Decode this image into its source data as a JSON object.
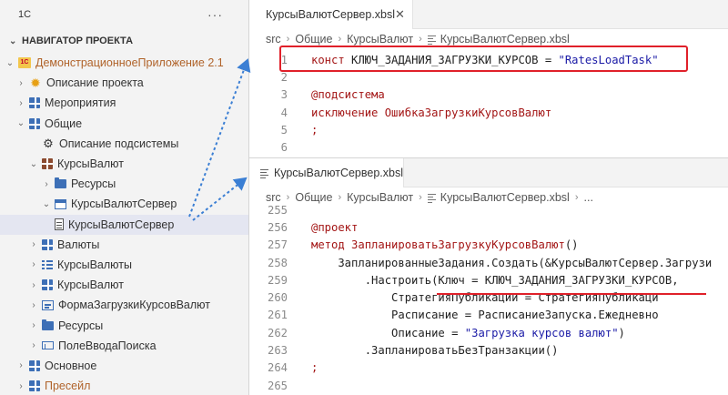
{
  "sidebar": {
    "title": "1С",
    "more": "···",
    "section": "НАВИГАТОР ПРОЕКТА",
    "tree": [
      {
        "label": "ДемонстрационноеПриложение 2.1",
        "icon": "project-1c-icon"
      },
      {
        "label": "Описание проекта",
        "icon": "gear-icon"
      },
      {
        "label": "Мероприятия",
        "icon": "grid-icon"
      },
      {
        "label": "Общие",
        "icon": "grid-icon"
      },
      {
        "label": "Описание подсистемы",
        "icon": "gears-icon"
      },
      {
        "label": "КурсыВалют",
        "icon": "grid-icon"
      },
      {
        "label": "Ресурсы",
        "icon": "folder-icon"
      },
      {
        "label": "КурсыВалютСервер",
        "icon": "module-icon"
      },
      {
        "label": "КурсыВалютСервер",
        "icon": "file-icon"
      },
      {
        "label": "Валюты",
        "icon": "grid-icon"
      },
      {
        "label": "КурсыВалюты",
        "icon": "enum-icon"
      },
      {
        "label": "КурсыВалют",
        "icon": "grid-icon"
      },
      {
        "label": "ФормаЗагрузкиКурсовВалют",
        "icon": "form-icon"
      },
      {
        "label": "Ресурсы",
        "icon": "folder-icon"
      },
      {
        "label": "ПолеВводаПоиска",
        "icon": "input-icon"
      },
      {
        "label": "Основное",
        "icon": "grid-icon"
      },
      {
        "label": "Пресейл",
        "icon": "grid-icon"
      }
    ]
  },
  "pane1": {
    "tab": "КурсыВалютСервер.xbsl",
    "breadcrumb": [
      "src",
      "Общие",
      "КурсыВалют",
      "КурсыВалютСервер.xbsl"
    ],
    "lines": [
      {
        "n": "1",
        "parts": [
          [
            "kw",
            "конст "
          ],
          [
            "",
            "КЛЮЧ_ЗАДАНИЯ_ЗАГРУЗКИ_КУРСОВ = "
          ],
          [
            "str",
            "\"RatesLoadTask\""
          ]
        ]
      },
      {
        "n": "2",
        "parts": []
      },
      {
        "n": "3",
        "parts": [
          [
            "ann",
            "@подсистема"
          ]
        ]
      },
      {
        "n": "4",
        "parts": [
          [
            "kw",
            "исключение "
          ],
          [
            "kw",
            "ОшибкаЗагрузкиКурсовВалют"
          ]
        ]
      },
      {
        "n": "5",
        "parts": [
          [
            "kw",
            ";"
          ]
        ]
      },
      {
        "n": "6",
        "parts": []
      }
    ]
  },
  "pane2": {
    "tab": "КурсыВалютСервер.xbsl",
    "breadcrumb": [
      "src",
      "Общие",
      "КурсыВалют",
      "КурсыВалютСервер.xbsl",
      "..."
    ],
    "lines": [
      {
        "n": "255",
        "parts": []
      },
      {
        "n": "256",
        "parts": [
          [
            "ann",
            "@проект"
          ]
        ]
      },
      {
        "n": "257",
        "parts": [
          [
            "kw",
            "метод "
          ],
          [
            "kw",
            "ЗапланироватьЗагрузкуКурсовВалют"
          ],
          [
            "",
            "()"
          ]
        ]
      },
      {
        "n": "258",
        "parts": [
          [
            "",
            "    ЗапланированныеЗадания.Создать(&КурсыВалютСервер.Загрузи"
          ]
        ]
      },
      {
        "n": "259",
        "parts": [
          [
            "",
            "        .Настроить(Ключ = КЛЮЧ_ЗАДАНИЯ_ЗАГРУЗКИ_КУРСОВ,"
          ]
        ]
      },
      {
        "n": "260",
        "parts": [
          [
            "",
            "            СтратегияПубликации = СтратегияПубликаци"
          ]
        ]
      },
      {
        "n": "261",
        "parts": [
          [
            "",
            "            Расписание = РасписаниеЗапуска.Ежедневно"
          ]
        ]
      },
      {
        "n": "262",
        "parts": [
          [
            "",
            "            Описание = "
          ],
          [
            "str",
            "\"Загрузка курсов валют\""
          ],
          [
            "",
            ")"
          ]
        ]
      },
      {
        "n": "263",
        "parts": [
          [
            "",
            "        .ЗапланироватьБезТранзакции()"
          ]
        ]
      },
      {
        "n": "264",
        "parts": [
          [
            "kw",
            ";"
          ]
        ]
      },
      {
        "n": "265",
        "parts": []
      }
    ]
  },
  "colors": {
    "highlight": "#e0202a",
    "arrow": "#3b7fd4",
    "keyword": "#a31515",
    "string": "#1a1aa6"
  }
}
